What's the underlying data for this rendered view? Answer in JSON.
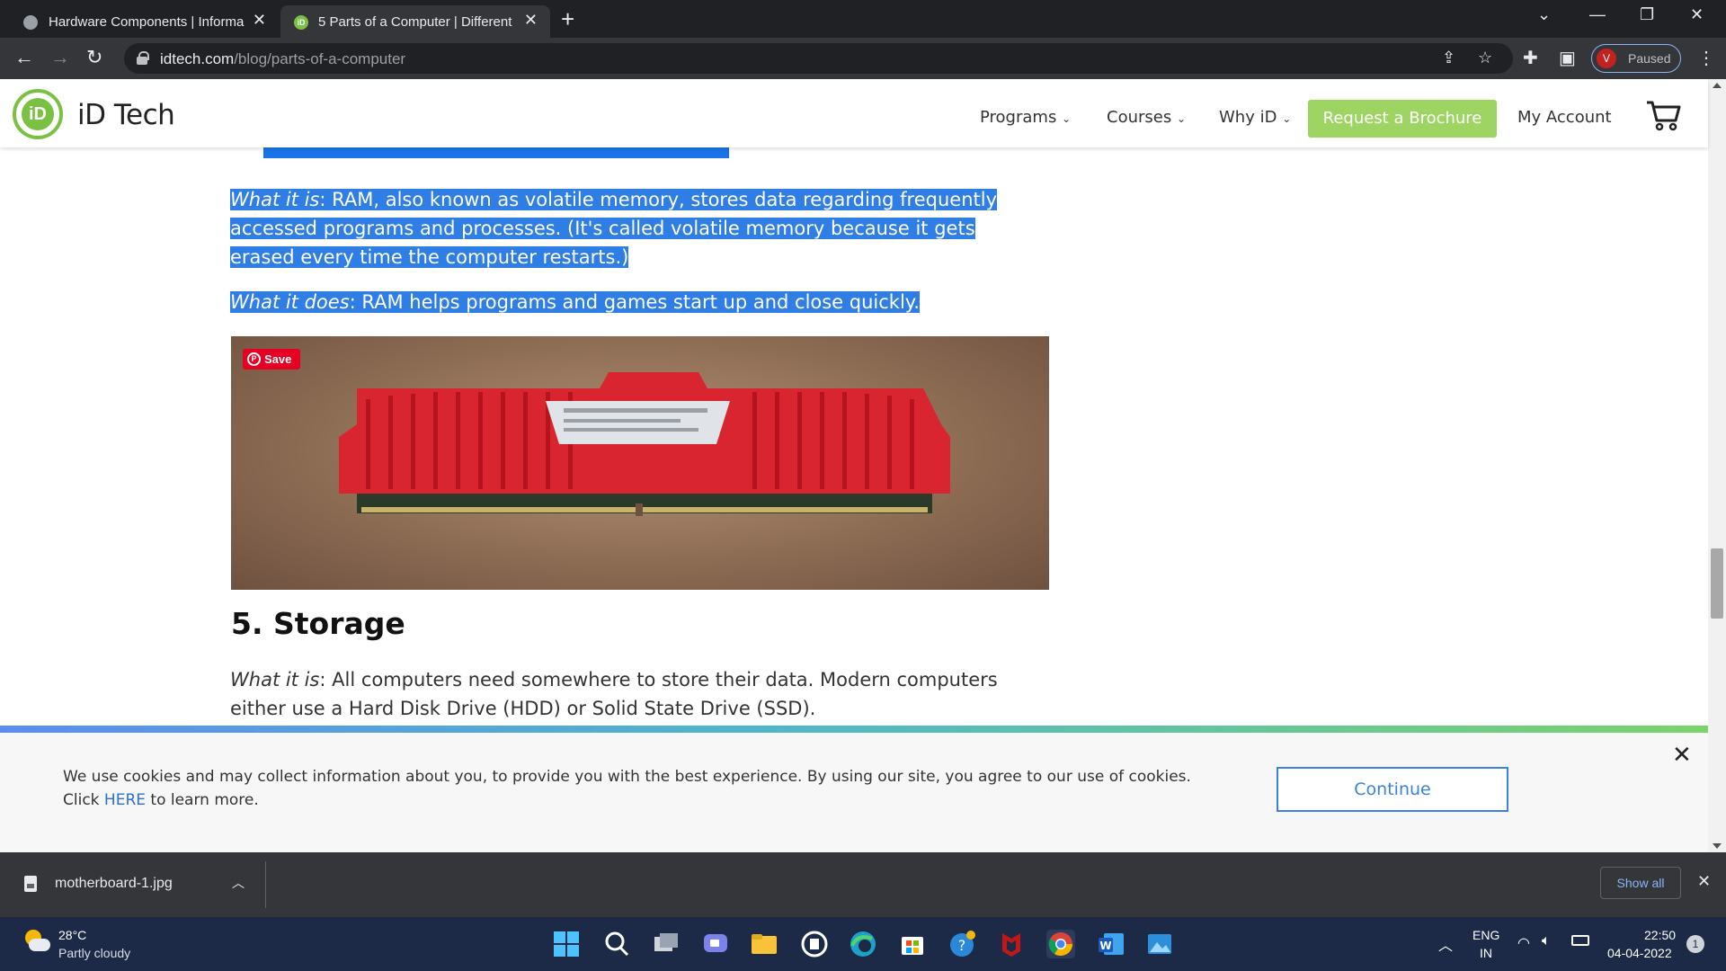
{
  "browser": {
    "tabs": [
      {
        "title": "Hardware Components | Informa",
        "active": false
      },
      {
        "title": "5 Parts of a Computer | Different",
        "active": true
      }
    ],
    "url": {
      "host": "idtech.com",
      "path": "/blog/parts-of-a-computer"
    },
    "profile": {
      "initial": "V",
      "status": "Paused"
    }
  },
  "site": {
    "logo_text": "iD Tech",
    "nav": [
      {
        "label": "Programs"
      },
      {
        "label": "Courses"
      },
      {
        "label": "Why iD"
      }
    ],
    "brochure_label": "Request a Brochure",
    "account_label": "My Account"
  },
  "article": {
    "ram_what_it_is_label": "What it is",
    "ram_what_it_is_text": ": RAM, also known as volatile memory, stores data regarding frequently accessed programs and processes. (It's called volatile memory because it gets erased every time the computer restarts.)",
    "ram_what_it_does_label": "What it does",
    "ram_what_it_does_text": ": RAM helps programs and games start up and close quickly.",
    "pin_save_label": "Save",
    "storage_heading": "5. Storage",
    "storage_what_it_is_label": "What it is",
    "storage_what_it_is_text": ": All computers need somewhere to store their data. Modern computers either use a Hard Disk Drive (HDD) or Solid State Drive (SSD)."
  },
  "cookie": {
    "text_before_link": "We use cookies and may collect information about you, to provide you with the best experience. By using our site, you agree to our use of cookies. Click ",
    "link_text": "HERE",
    "text_after_link": " to learn more.",
    "continue_label": "Continue"
  },
  "downloads": {
    "file_name": "motherboard-1.jpg",
    "show_all_label": "Show all"
  },
  "taskbar": {
    "weather_temp": "28°C",
    "weather_desc": "Partly cloudy",
    "language_line1": "ENG",
    "language_line2": "IN",
    "time": "22:50",
    "date": "04-04-2022",
    "notification_count": "1"
  },
  "colors": {
    "brand_green": "#7ac143",
    "brochure_green": "#9ed461",
    "selection_blue": "#2f7ee6",
    "continue_blue": "#3b82d8"
  }
}
